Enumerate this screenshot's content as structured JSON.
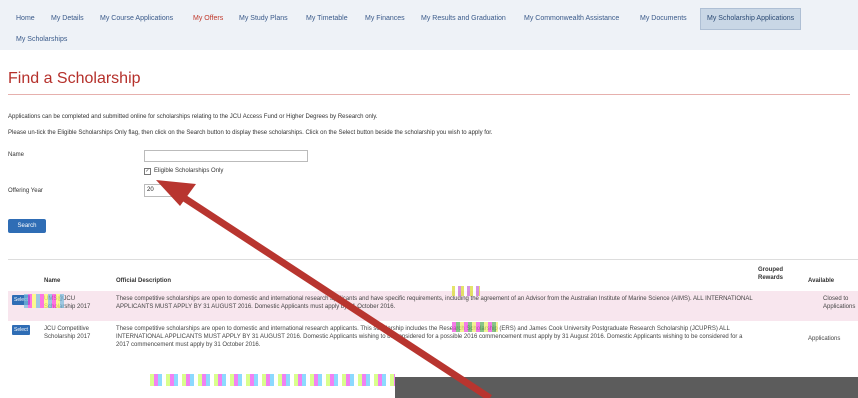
{
  "nav": {
    "items": [
      {
        "label": "Home"
      },
      {
        "label": "My Details"
      },
      {
        "label": "My Course Applications"
      },
      {
        "label": "My Offers"
      },
      {
        "label": "My Study Plans"
      },
      {
        "label": "My Timetable"
      },
      {
        "label": "My Finances"
      },
      {
        "label": "My Results and Graduation"
      },
      {
        "label": "My Commonwealth Assistance"
      },
      {
        "label": "My Documents"
      },
      {
        "label": "My Scholarship Applications"
      },
      {
        "label": "My Scholarships"
      }
    ]
  },
  "page": {
    "title": "Find a Scholarship",
    "intro1": "Applications can be completed and submitted online for scholarships relating to the JCU Access Fund or Higher Degrees by Research only.",
    "intro2": "Please un-tick the Eligible Scholarships Only flag, then click on the Search button to display these scholarships. Click on the Select button beside the scholarship you wish to apply for."
  },
  "form": {
    "name_label": "Name",
    "name_value": "",
    "eligible_label": "Eligible Scholarships Only",
    "offering_year_label": "Offering Year",
    "offering_year_value": "20",
    "search_label": "Search"
  },
  "table": {
    "headers": {
      "name": "Name",
      "description": "Official Description",
      "grouped": "Grouped Rewards",
      "available": "Available"
    },
    "rows": [
      {
        "select": "Select",
        "name": "UMS@JCU Scholarship 2017",
        "description": "These competitive scholarships are open to domestic and international research applicants and have specific requirements, including the agreement of an Advisor from the Australian Institute of Marine Science (AIMS). ALL INTERNATIONAL APPLICANTS MUST APPLY BY 31 AUGUST 2016. Domestic Applicants must apply by 31 October 2016.",
        "available": "Closed to Applications"
      },
      {
        "select": "Select",
        "name": "JCU Competitive Scholarship 2017",
        "description": "These competitive scholarships are open to domestic and international research applicants. This scholarship includes the Research Scholarship (ERS) and James Cook University Postgraduate Research Scholarship (JCUPRS) ALL INTERNATIONAL APPLICANTS MUST APPLY BY 31 AUGUST 2016. Domestic Applicants wishing to be considered for a possible 2016 commencement must apply by 31 August 2016. Domestic Applicants wishing to be considered for a 2017 commencement must apply by 31 October 2016.",
        "available": "Applications"
      }
    ]
  },
  "colors": {
    "accent": "#b5302b",
    "link": "#3a5a8a",
    "button": "#2f6db5",
    "arrow": "#b8352f"
  }
}
